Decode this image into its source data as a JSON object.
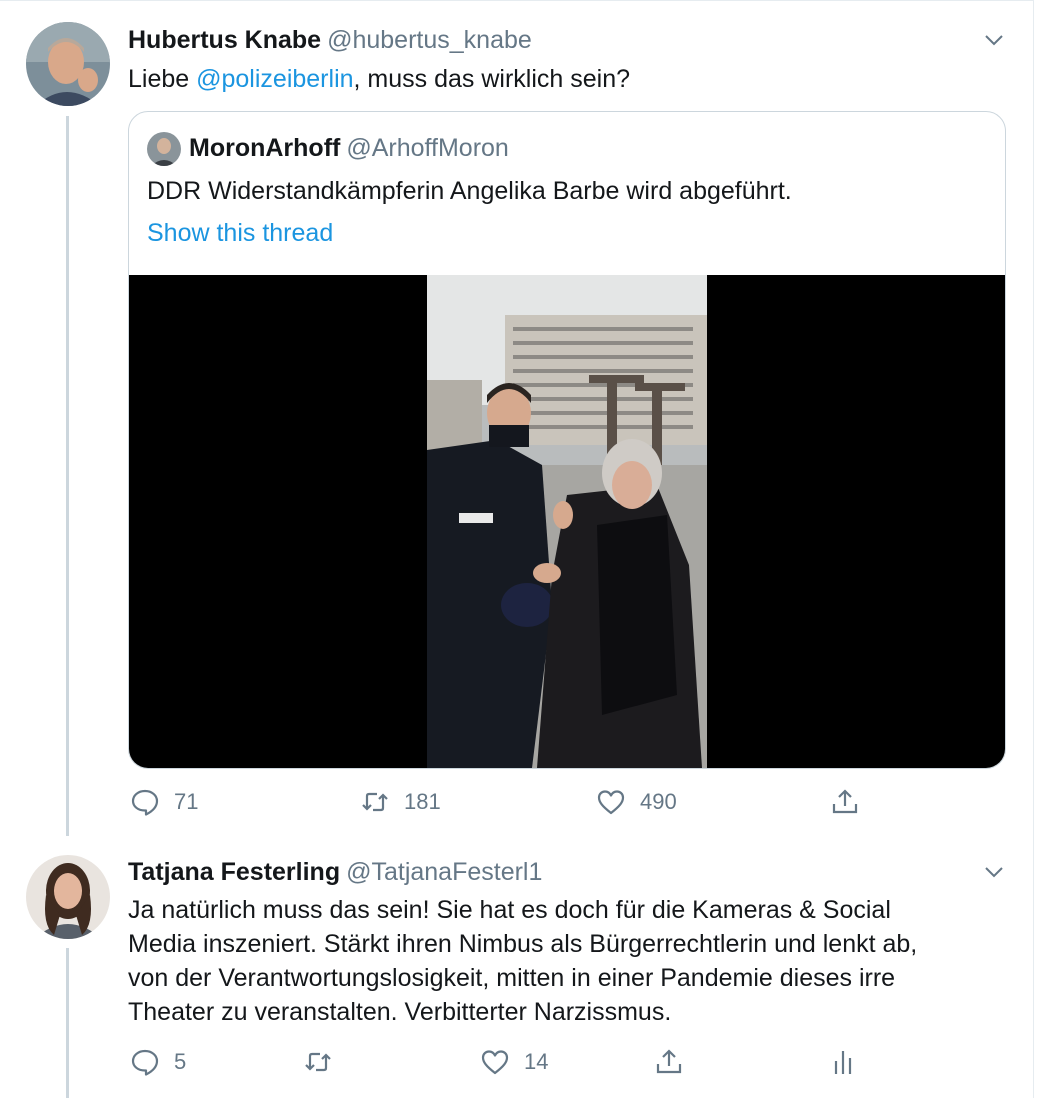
{
  "tweets": [
    {
      "display_name": "Hubertus Knabe",
      "handle": "@hubertus_knabe",
      "text_before": "Liebe ",
      "mention": "@polizeiberlin",
      "text_after": ", muss das wirklich sein?",
      "quote": {
        "display_name": "MoronArhoff",
        "handle": "@ArhoffMoron",
        "text": "DDR Widerstandkämpferin Angelika Barbe wird abgeführt.",
        "show_thread": "Show this thread"
      },
      "actions": {
        "replies": "71",
        "retweets": "181",
        "likes": "490"
      }
    },
    {
      "display_name": "Tatjana Festerling",
      "handle": "@TatjanaFesterl1",
      "text_lines": [
        "Ja natürlich muss das sein! Sie hat es doch für die Kameras & Social",
        "Media inszeniert. Stärkt ihren Nimbus als Bürgerrechtlerin und lenkt ab,",
        "von der Verantwortungslosigkeit, mitten in einer Pandemie dieses irre",
        "Theater zu veranstalten. Verbitterter Narzissmus."
      ],
      "actions": {
        "replies": "5",
        "retweets": "",
        "likes": "14"
      }
    }
  ],
  "icons": {
    "reply": "reply-icon",
    "retweet": "retweet-icon",
    "like": "heart-icon",
    "share": "share-icon",
    "analytics": "analytics-icon",
    "caret": "chevron-down-icon"
  },
  "colors": {
    "link": "#1b95e0",
    "secondary_text": "#657786",
    "border": "#ccd6dd"
  }
}
